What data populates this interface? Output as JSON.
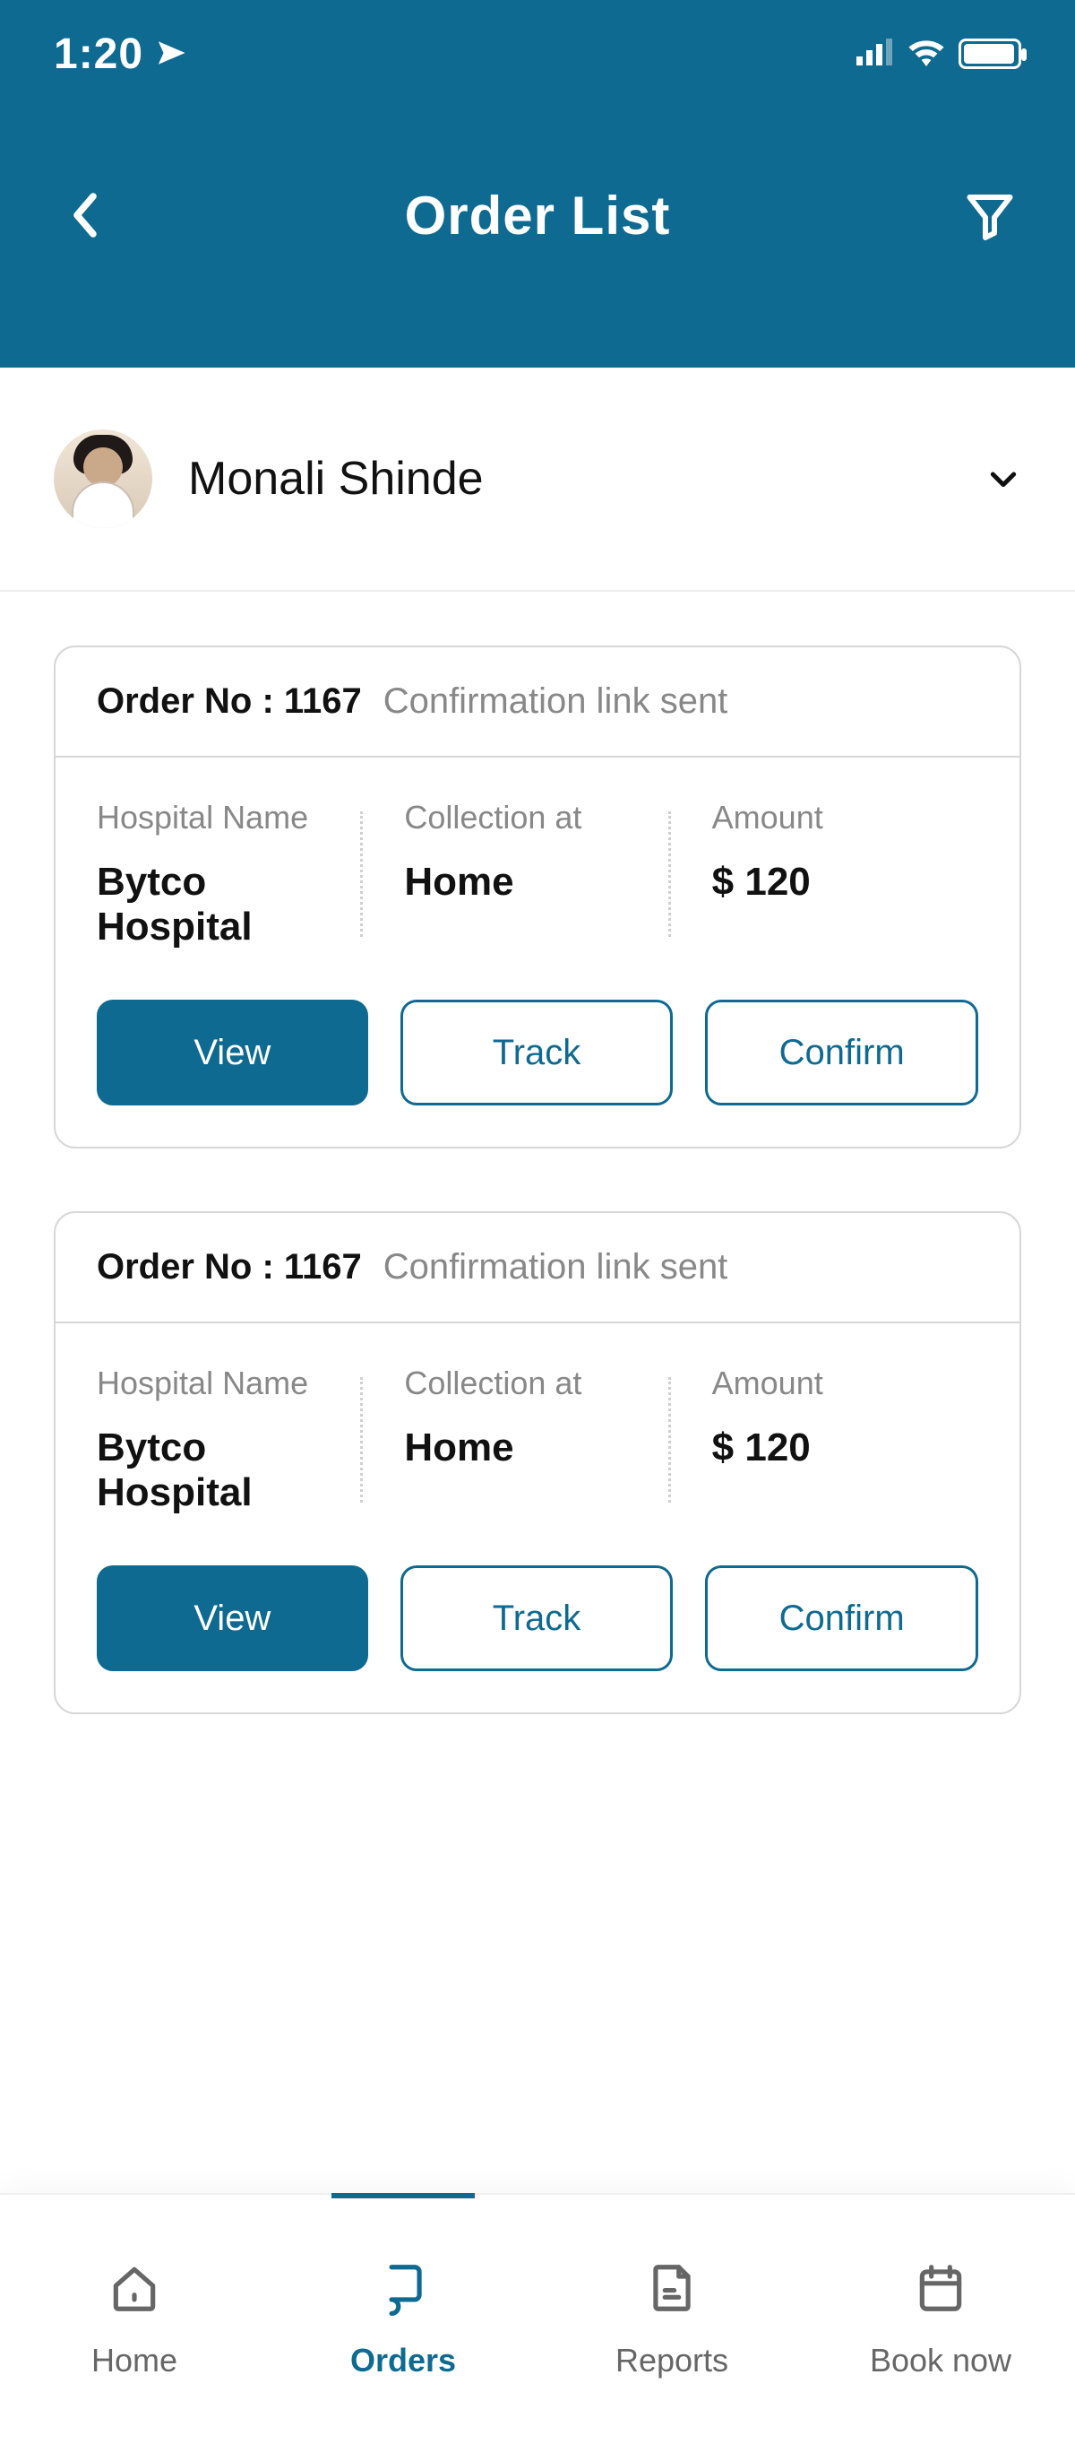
{
  "status_bar": {
    "time": "1:20"
  },
  "header": {
    "title": "Order List"
  },
  "profile": {
    "name": "Monali Shinde"
  },
  "labels": {
    "order_no_prefix": "Order No : ",
    "hospital": "Hospital Name",
    "collection": "Collection at",
    "amount": "Amount"
  },
  "buttons": {
    "view": "View",
    "track": "Track",
    "confirm": "Confirm"
  },
  "orders": [
    {
      "order_no": "1167",
      "status": "Confirmation link sent",
      "hospital": "Bytco Hospital",
      "collection": "Home",
      "amount": "$ 120"
    },
    {
      "order_no": "1167",
      "status": "Confirmation link sent",
      "hospital": "Bytco Hospital",
      "collection": "Home",
      "amount": "$ 120"
    }
  ],
  "tabs": {
    "home": "Home",
    "orders": "Orders",
    "reports": "Reports",
    "book": "Book now"
  }
}
